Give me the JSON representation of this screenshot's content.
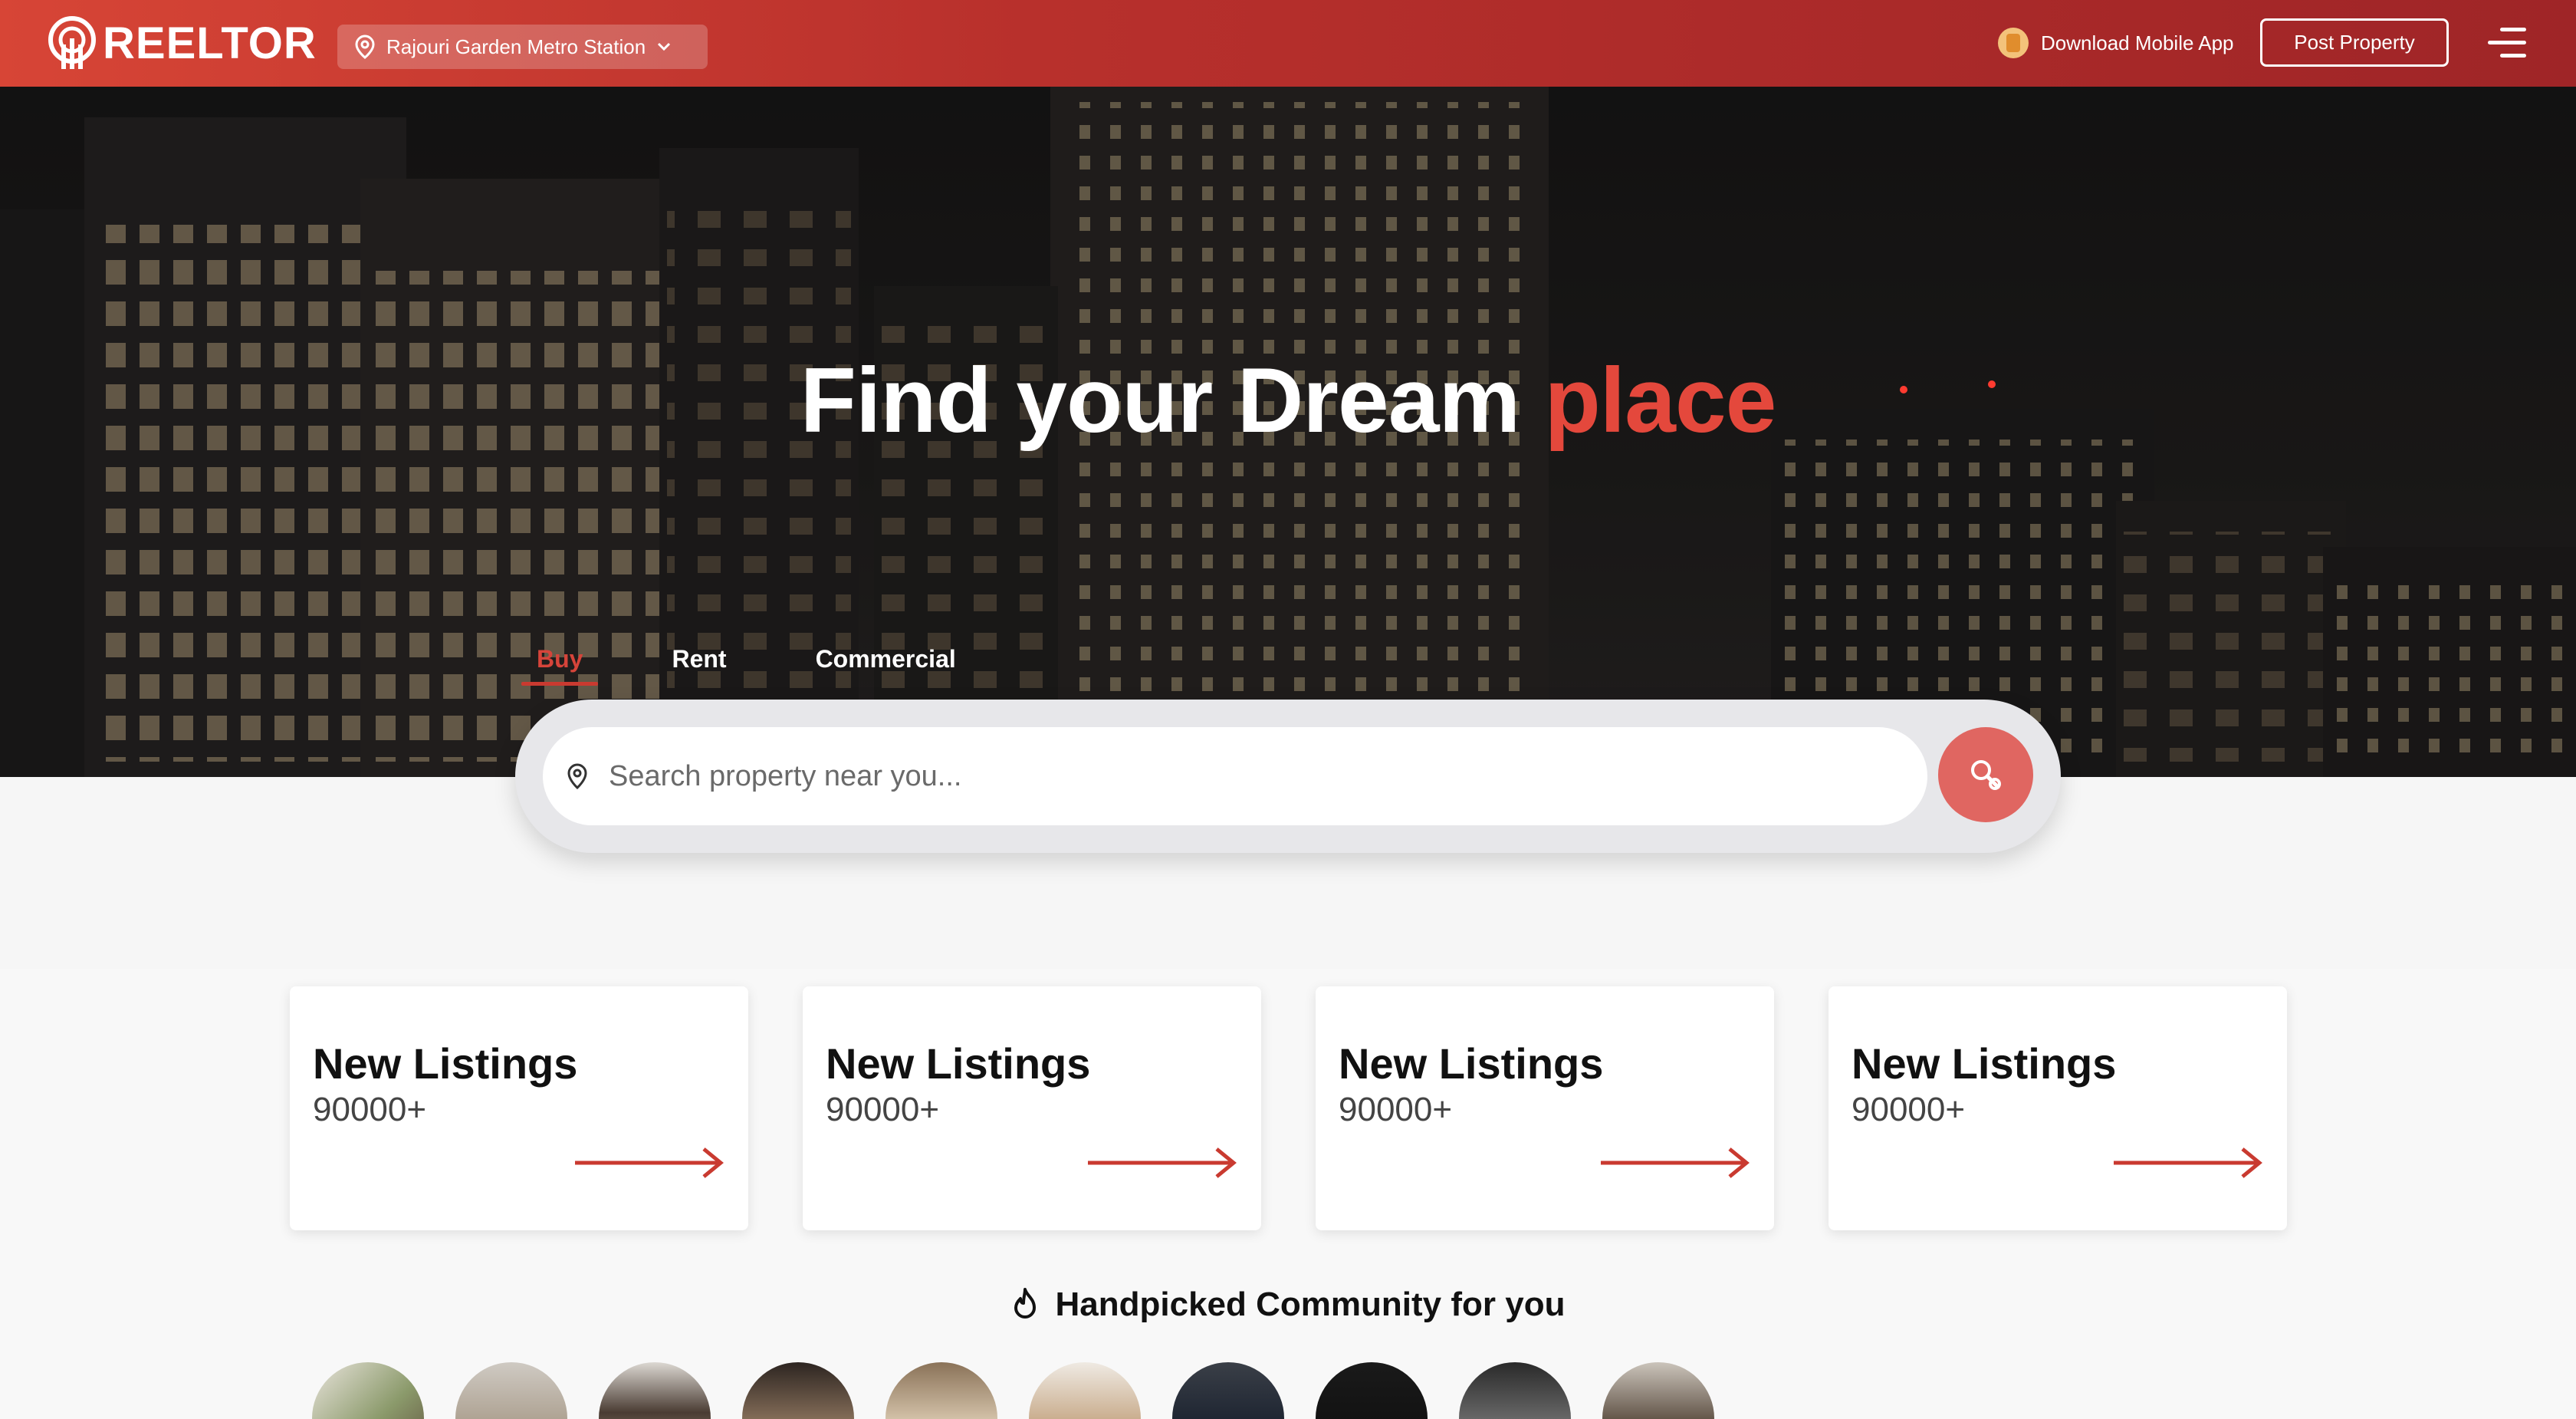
{
  "header": {
    "brand": "REELTOR",
    "location": "Rajouri Garden Metro Station",
    "download_app": "Download Mobile App",
    "post_property": "Post Property"
  },
  "hero": {
    "title_main": "Find your Dream",
    "title_accent": "place",
    "tabs": [
      {
        "label": "Buy",
        "active": true
      },
      {
        "label": "Rent",
        "active": false
      },
      {
        "label": "Commercial",
        "active": false
      }
    ]
  },
  "search": {
    "placeholder": "Search property near you..."
  },
  "cards": [
    {
      "title": "New Listings",
      "count": "90000+"
    },
    {
      "title": "New Listings",
      "count": "90000+"
    },
    {
      "title": "New Listings",
      "count": "90000+"
    },
    {
      "title": "New Listings",
      "count": "90000+"
    }
  ],
  "community": {
    "title": "Handpicked Community for you"
  },
  "colors": {
    "brand_red": "#d6443a",
    "header_gradient_start": "#d74536",
    "header_gradient_end": "#9f2527",
    "search_button": "#e06661"
  }
}
